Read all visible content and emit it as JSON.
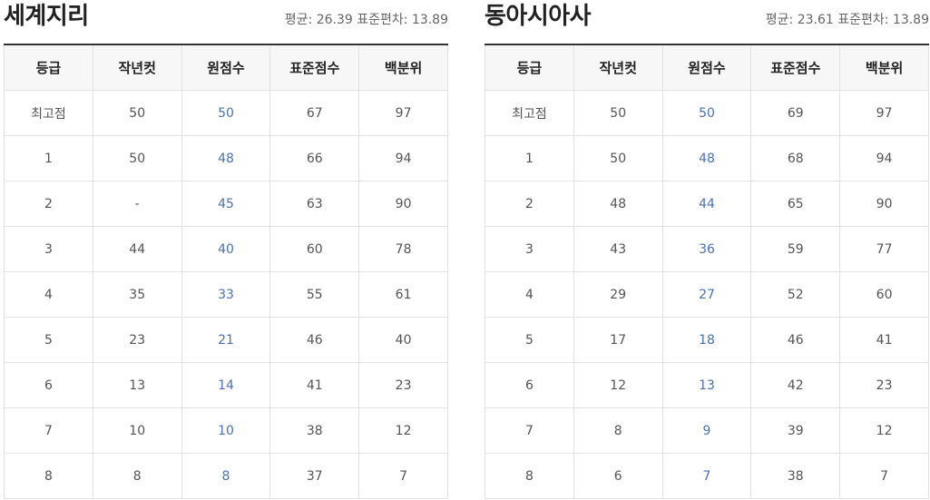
{
  "panels": [
    {
      "title": "세계지리",
      "stats": "평균: 26.39 표준편차: 13.89",
      "headers": [
        "등급",
        "작년컷",
        "원점수",
        "표준점수",
        "백분위"
      ],
      "rows": [
        [
          "최고점",
          "50",
          "50",
          "67",
          "97"
        ],
        [
          "1",
          "50",
          "48",
          "66",
          "94"
        ],
        [
          "2",
          "-",
          "45",
          "63",
          "90"
        ],
        [
          "3",
          "44",
          "40",
          "60",
          "78"
        ],
        [
          "4",
          "35",
          "33",
          "55",
          "61"
        ],
        [
          "5",
          "23",
          "21",
          "46",
          "40"
        ],
        [
          "6",
          "13",
          "14",
          "41",
          "23"
        ],
        [
          "7",
          "10",
          "10",
          "38",
          "12"
        ],
        [
          "8",
          "8",
          "8",
          "37",
          "7"
        ]
      ]
    },
    {
      "title": "동아시아사",
      "stats": "평균: 23.61 표준편차: 13.89",
      "headers": [
        "등급",
        "작년컷",
        "원점수",
        "표준점수",
        "백분위"
      ],
      "rows": [
        [
          "최고점",
          "50",
          "50",
          "69",
          "97"
        ],
        [
          "1",
          "50",
          "48",
          "68",
          "94"
        ],
        [
          "2",
          "48",
          "44",
          "65",
          "90"
        ],
        [
          "3",
          "43",
          "36",
          "59",
          "77"
        ],
        [
          "4",
          "29",
          "27",
          "52",
          "60"
        ],
        [
          "5",
          "17",
          "18",
          "46",
          "41"
        ],
        [
          "6",
          "12",
          "13",
          "42",
          "23"
        ],
        [
          "7",
          "8",
          "9",
          "39",
          "12"
        ],
        [
          "8",
          "6",
          "7",
          "38",
          "7"
        ]
      ]
    }
  ],
  "colors": {
    "raw_score": "#4b72b5",
    "header_bg": "#f7f7f7",
    "border": "#e2e2e2",
    "top_border": "#333333"
  }
}
